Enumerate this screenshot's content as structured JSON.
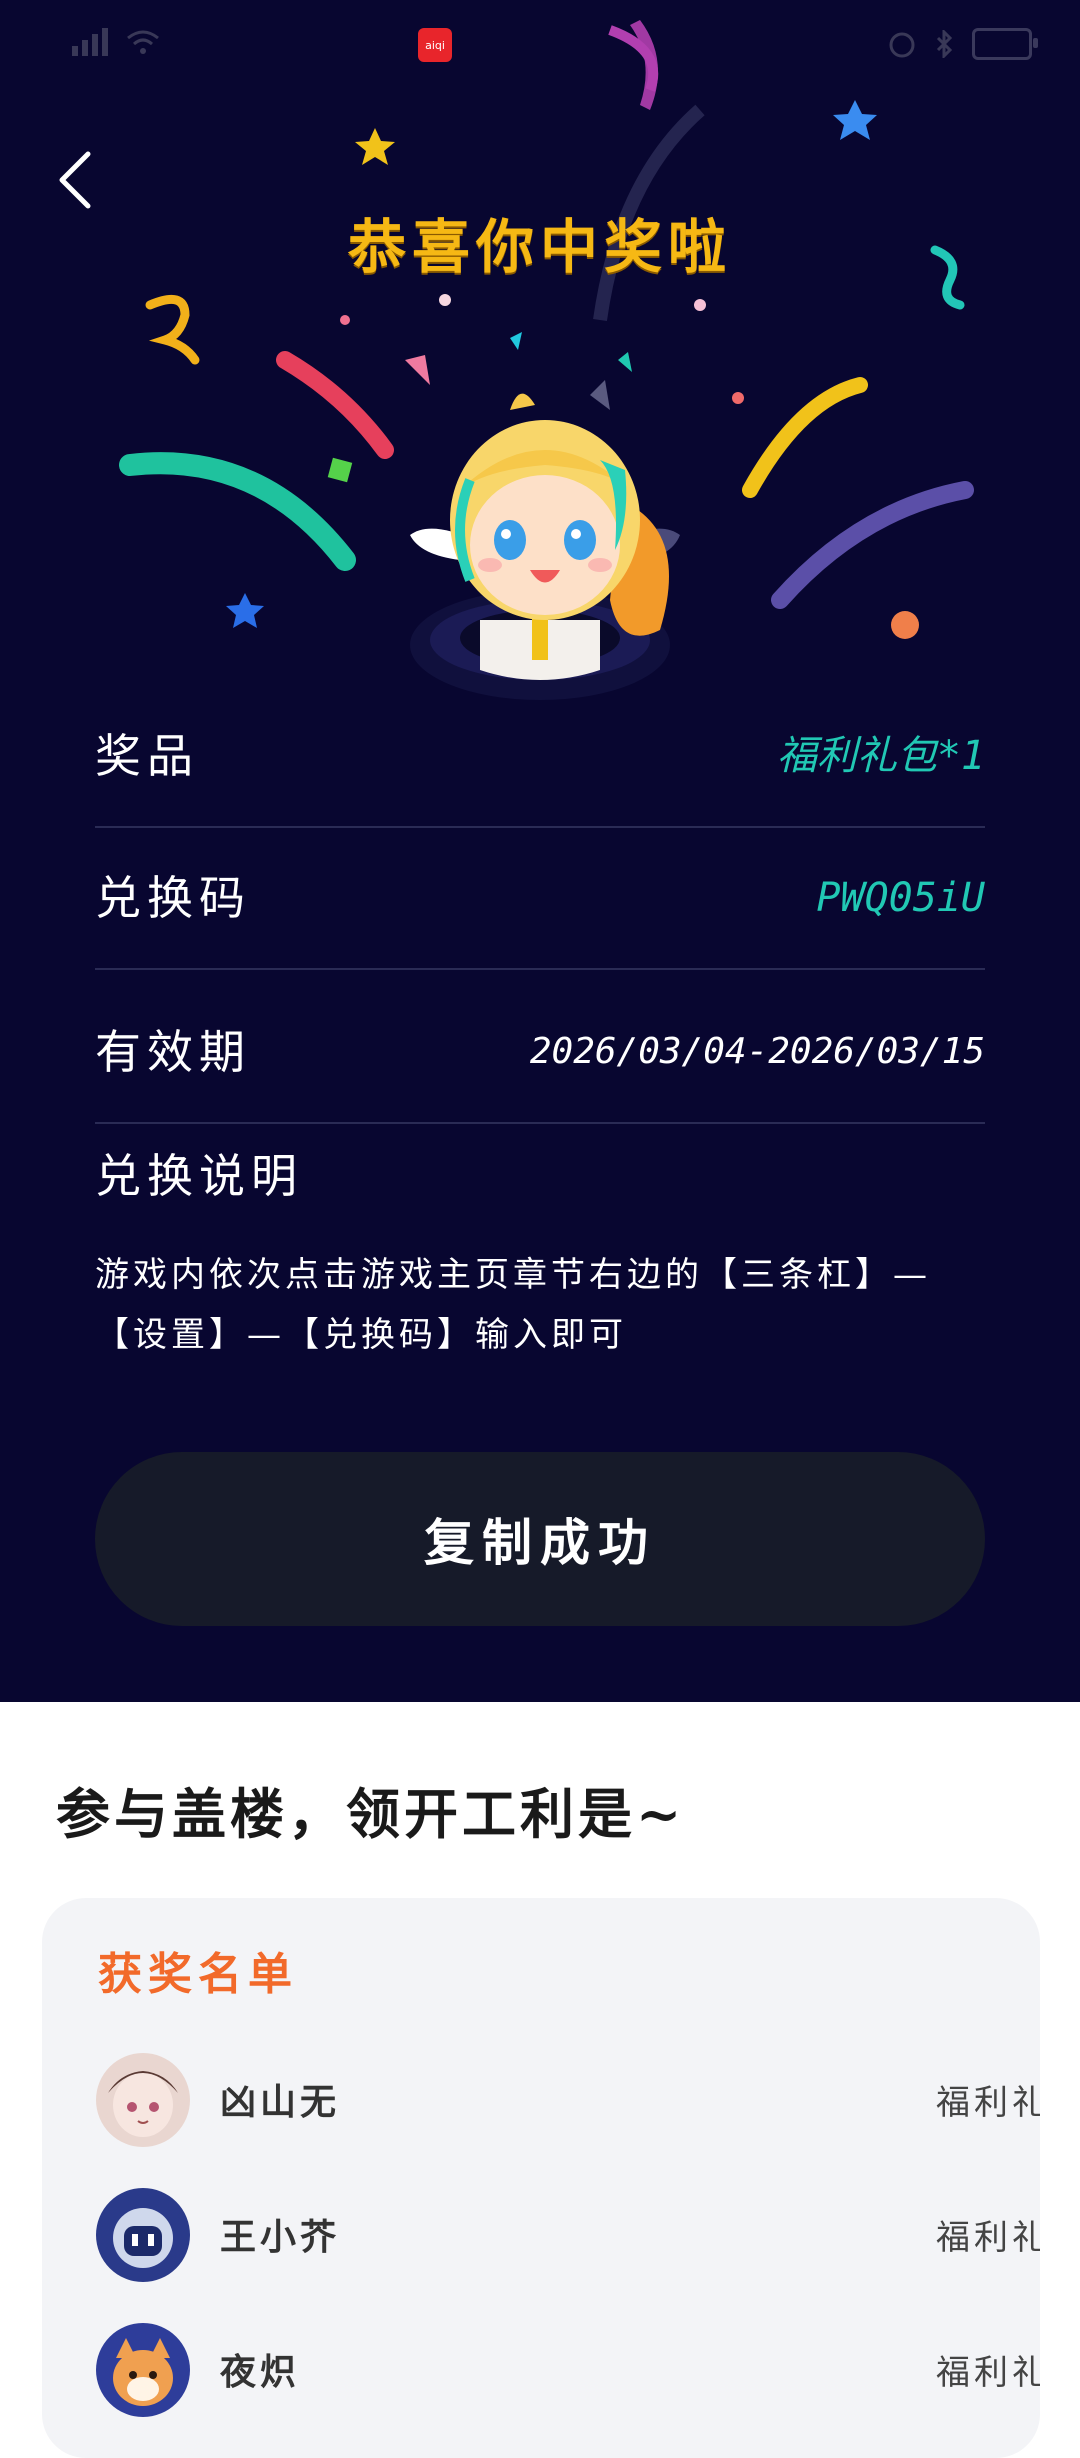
{
  "status_bar": {
    "app_badge": "aiqi"
  },
  "header": {
    "title": "恭喜你中奖啦"
  },
  "prize_info": {
    "rows": [
      {
        "label": "奖品",
        "value": "福利礼包*1"
      },
      {
        "label": "兑换码",
        "value": "PWQ05iU"
      },
      {
        "label": "有效期",
        "value": "2026/03/04-2026/03/15"
      }
    ],
    "instructions_title": "兑换说明",
    "instructions_text": "游戏内依次点击游戏主页章节右边的【三条杠】—【设置】—【兑换码】输入即可"
  },
  "copy_button": {
    "label": "复制成功"
  },
  "community": {
    "title": "参与盖楼，领开工利是~"
  },
  "winners": {
    "title": "获奖名单",
    "items": [
      {
        "name": "凶山无",
        "prize": "福利礼包"
      },
      {
        "name": "王小芥",
        "prize": "福利礼包"
      },
      {
        "name": "夜炽",
        "prize": "福利礼包"
      }
    ]
  },
  "colors": {
    "background": "#080630",
    "headline": "#f6b814",
    "accent_teal": "#21c8b4",
    "button_bg": "#161a29",
    "winner_title": "#f26a2a"
  }
}
